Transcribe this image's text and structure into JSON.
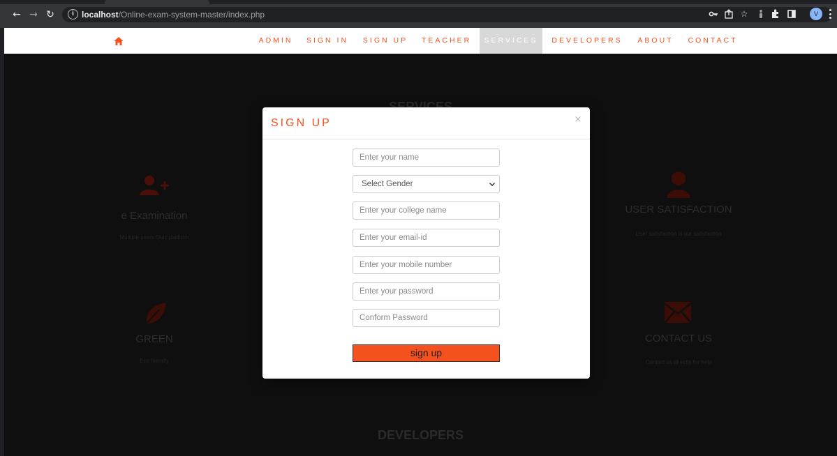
{
  "browser": {
    "url_host": "localhost",
    "url_path": "/Online-exam-system-master/index.php",
    "avatar_letter": "V"
  },
  "nav": {
    "items": [
      {
        "label": "ADMIN"
      },
      {
        "label": "SIGN IN"
      },
      {
        "label": "SIGN UP"
      },
      {
        "label": "TEACHER"
      },
      {
        "label": "SERVICES"
      },
      {
        "label": "DEVELOPERS"
      },
      {
        "label": "ABOUT"
      },
      {
        "label": "CONTACT"
      }
    ],
    "active": "SERVICES"
  },
  "background": {
    "services_heading": "SERVICES",
    "developers_heading": "DEVELOPERS",
    "services": [
      {
        "title": "e Examination",
        "desc": "Multiple users Quiz platform"
      },
      {
        "title": "GREEN",
        "desc": "Eco friendly"
      },
      {
        "title": "USER SATISFACTION",
        "desc": "User satisfaction is our satisfaction"
      },
      {
        "title": "CONTACT US",
        "desc": "Contact us directly for help"
      }
    ]
  },
  "modal": {
    "title": "SIGN UP",
    "close_label": "×",
    "fields": {
      "name_placeholder": "Enter your name",
      "gender_selected": "Select Gender",
      "college_placeholder": "Enter your college name",
      "email_placeholder": "Enter your email-id",
      "mobile_placeholder": "Enter your mobile number",
      "password_placeholder": "Enter your password",
      "confirm_placeholder": "Conform Password"
    },
    "submit_label": "sign up"
  },
  "colors": {
    "accent": "#f4511e",
    "page_bg": "#0f0f0f",
    "nav_active_bg": "#d8d8d8"
  }
}
